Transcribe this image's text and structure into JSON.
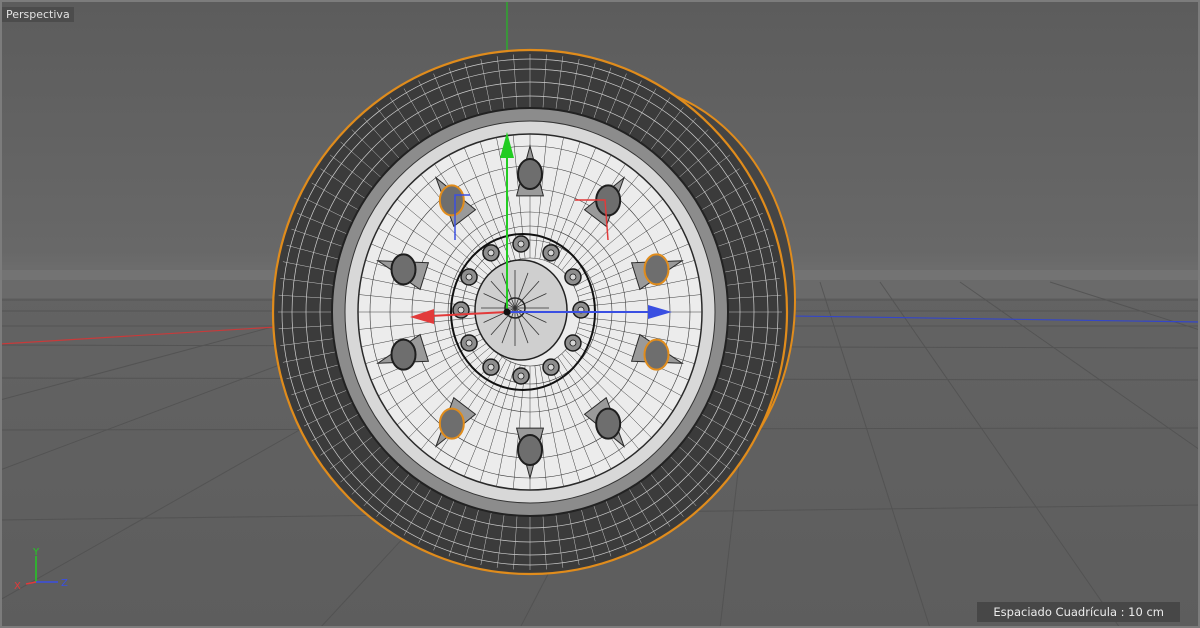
{
  "viewport": {
    "label": "Perspectiva",
    "grid_spacing_label": "Espaciado Cuadrícula : 10 cm"
  },
  "axis_gizmo": {
    "y_label": "Y",
    "x_label": "X",
    "z_label": "Z"
  },
  "colors": {
    "x_axis": "#e23a3a",
    "y_axis": "#22cc22",
    "z_axis": "#3a4fe2",
    "selection": "#e08c1c"
  },
  "scene": {
    "object": "wheel-rim",
    "shading": "wireframe"
  }
}
